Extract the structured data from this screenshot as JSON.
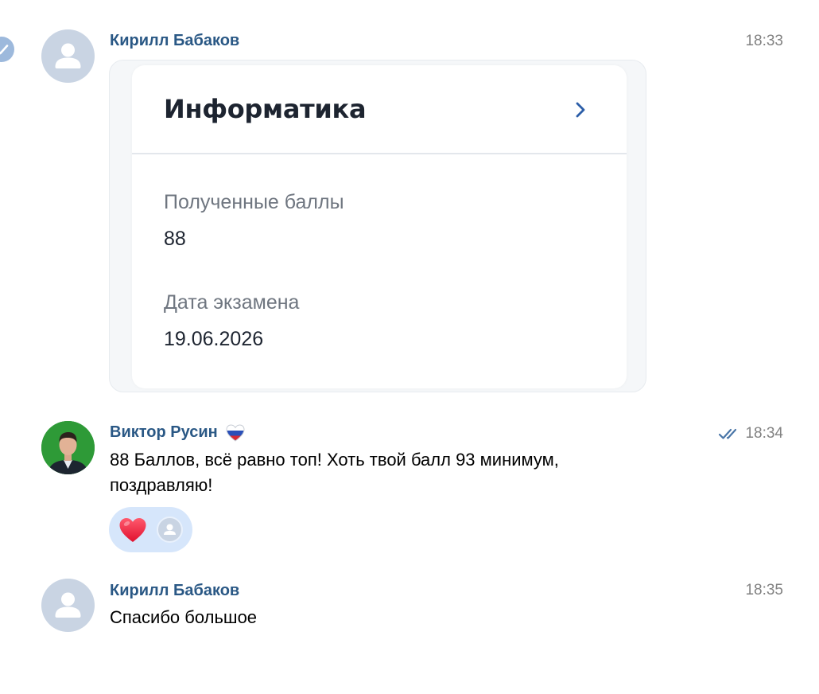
{
  "messages": [
    {
      "author": "Кирилл Бабаков",
      "time": "18:33",
      "card": {
        "title": "Информатика",
        "fields": [
          {
            "label": "Полученные баллы",
            "value": "88"
          },
          {
            "label": "Дата экзамена",
            "value": "19.06.2026"
          }
        ]
      }
    },
    {
      "author": "Виктор Русин",
      "time": "18:34",
      "text": "88 Баллов, всё равно топ! Хоть твой балл 93 минимум, поздравляю!",
      "reaction": {
        "emoji": "heart-icon"
      }
    },
    {
      "author": "Кирилл Бабаков",
      "time": "18:35",
      "text": "Спасибо большое"
    }
  ],
  "colors": {
    "author": "#2a5885",
    "time": "#828282",
    "reaction_bg": "#d6e6fb",
    "read_check": "#4a76a8"
  }
}
